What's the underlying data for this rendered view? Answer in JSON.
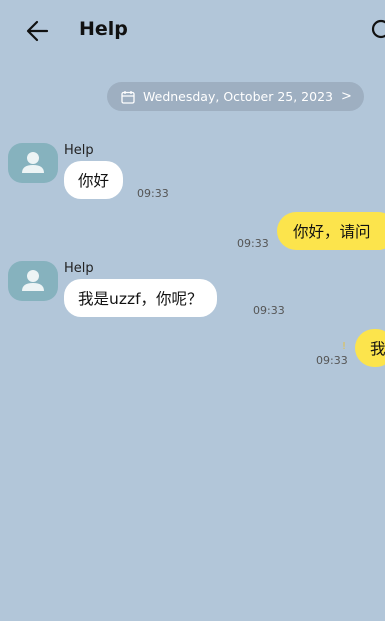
{
  "header": {
    "title": "Help"
  },
  "date_separator": {
    "text": "Wednesday, October 25, 2023",
    "chevron": ">"
  },
  "messages": [
    {
      "sender": "Help",
      "text": "你好",
      "time": "09:33"
    },
    {
      "text": "你好，请问",
      "time": "09:33"
    },
    {
      "sender": "Help",
      "text": "我是uzzf，你呢？",
      "time": "09:33"
    },
    {
      "text": "我",
      "time": "09:33",
      "status": "!"
    }
  ],
  "colors": {
    "background": "#b2c6d9",
    "outgoing_bubble": "#fce44c",
    "incoming_bubble": "#ffffff",
    "avatar": "#86b2be"
  },
  "icons": [
    "back-arrow-icon",
    "search-icon",
    "calendar-icon",
    "chevron-right-icon",
    "person-icon"
  ]
}
